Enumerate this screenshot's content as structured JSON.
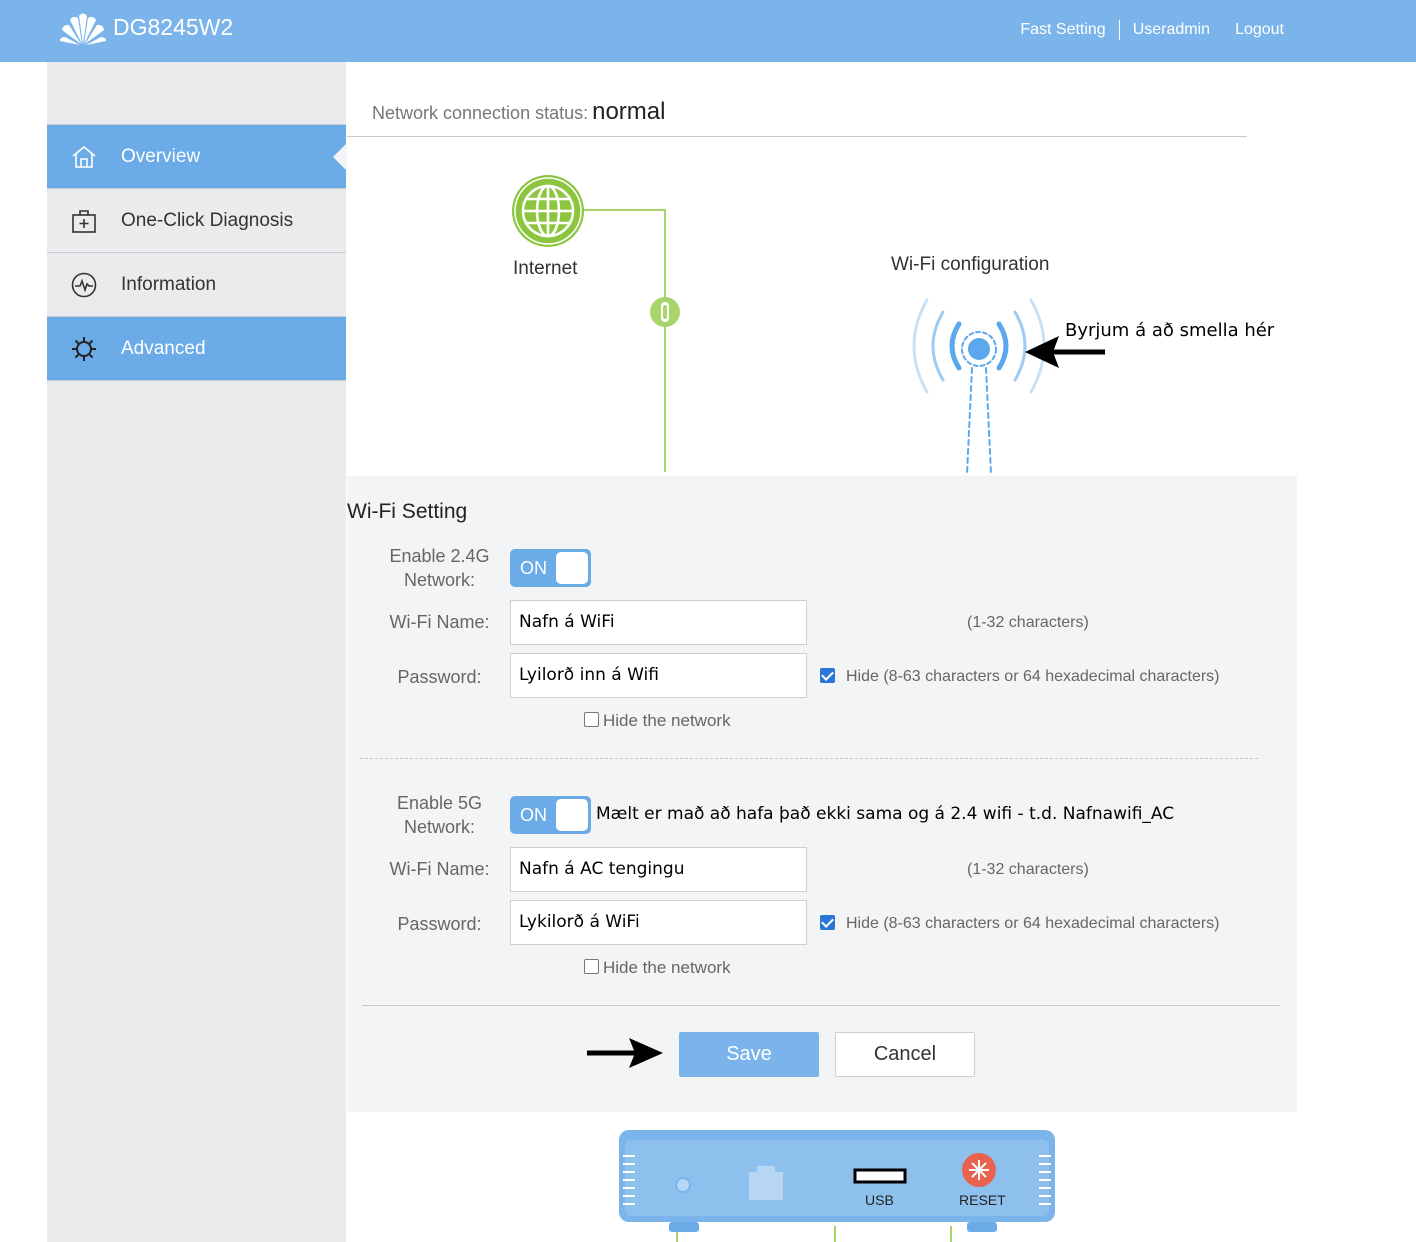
{
  "header": {
    "model": "DG8245W2",
    "links": [
      "Fast Setting",
      "Useradmin",
      "Logout"
    ]
  },
  "sidebar": {
    "items": [
      {
        "label": "Overview",
        "icon": "home-icon",
        "active": true
      },
      {
        "label": "One-Click Diagnosis",
        "icon": "medical-kit-icon",
        "active": false
      },
      {
        "label": "Information",
        "icon": "pulse-icon",
        "active": false
      },
      {
        "label": "Advanced",
        "icon": "gear-icon",
        "active": true
      }
    ]
  },
  "topology": {
    "status_label": "Network connection status:",
    "status_value": "normal",
    "internet_label": "Internet",
    "wifi_label": "Wi-Fi configuration",
    "annotation": "Byrjum á að smella hér"
  },
  "wifi_setting": {
    "title": "Wi-Fi Setting",
    "band24": {
      "enable_label": "Enable 2.4G Network:",
      "toggle": "ON",
      "name_label": "Wi-Fi Name:",
      "name_value": "Nafn á WiFi",
      "name_hint": "(1-32 characters)",
      "password_label": "Password:",
      "password_value": "Lyilorð inn á Wifi",
      "password_hint": "Hide (8-63 characters or 64 hexadecimal characters)",
      "hide_network": "Hide the network"
    },
    "band5": {
      "enable_label": "Enable 5G Network:",
      "toggle": "ON",
      "note": "Mælt er mað að hafa það ekki sama og á 2.4 wifi - t.d. Nafnawifi_AC",
      "name_label": "Wi-Fi Name:",
      "name_value": "Nafn á AC tengingu",
      "name_hint": "(1-32 characters)",
      "password_label": "Password:",
      "password_value": "Lykilorð á WiFi",
      "password_hint": "Hide (8-63 characters or 64 hexadecimal characters)",
      "hide_network": "Hide the network"
    },
    "save": "Save",
    "cancel": "Cancel"
  },
  "device": {
    "usb_label": "USB",
    "reset_label": "RESET"
  },
  "colors": {
    "header": "#7bb4ea",
    "active_nav": "#6aabe8",
    "internet_green": "#8cc63f",
    "wifi_blue": "#5ba8ec",
    "reset_red": "#e8624f"
  }
}
